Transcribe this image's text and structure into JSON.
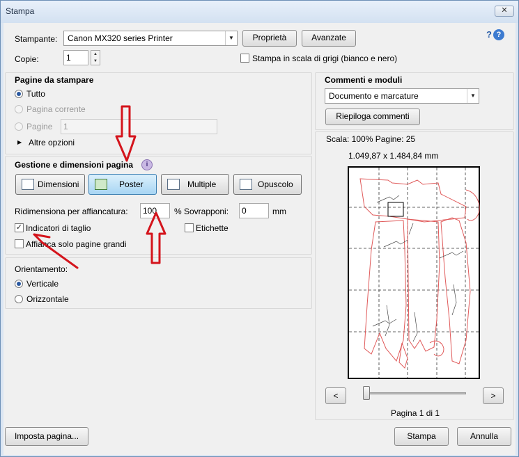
{
  "window": {
    "title": "Stampa",
    "close_label": "✕"
  },
  "printer": {
    "label": "Stampante:",
    "selected": "Canon MX320 series Printer",
    "properties_button": "Proprietà",
    "advanced_button": "Avanzate",
    "help": "?"
  },
  "copies": {
    "label": "Copie:",
    "value": "1"
  },
  "grayscale": {
    "label": "Stampa in scala di grigi (bianco e nero)",
    "checked": false
  },
  "pages": {
    "title": "Pagine da stampare",
    "all": "Tutto",
    "current": "Pagina corrente",
    "pages": "Pagine",
    "pages_value": "1",
    "more": "Altre opzioni"
  },
  "sizing": {
    "title": "Gestione e dimensioni pagina",
    "info_icon": "i",
    "buttons": [
      "Dimensioni",
      "Poster",
      "Multiple",
      "Opuscolo"
    ],
    "active": "Poster",
    "tile_scale_label": "Ridimensiona per affiancatura:",
    "tile_scale_value": "100",
    "percent": "%",
    "overlap_label": "Sovrapponi:",
    "overlap_value": "0",
    "unit": "mm",
    "cut_marks": "Indicatori di taglio",
    "cut_marks_checked": true,
    "labels": "Etichette",
    "labels_checked": false,
    "tile_large": "Affianca solo pagine grandi",
    "tile_large_checked": false
  },
  "orientation": {
    "title": "Orientamento:",
    "portrait": "Verticale",
    "landscape": "Orizzontale"
  },
  "comments": {
    "title": "Commenti e moduli",
    "selected": "Documento e marcature",
    "summary_button": "Riepiloga commenti"
  },
  "preview": {
    "scale_text": "Scala: 100% Pagine: 25",
    "dimensions": "1.049,87 x 1.484,84 mm",
    "prev": "<",
    "next": ">",
    "page_label": "Pagina 1 di 1",
    "slider_position": 0
  },
  "footer": {
    "page_setup": "Imposta pagina...",
    "print": "Stampa",
    "cancel": "Annulla"
  },
  "colors": {
    "arrow": "#d4141c",
    "pattern": "#e05a5a",
    "accent": "#2a58a0"
  }
}
